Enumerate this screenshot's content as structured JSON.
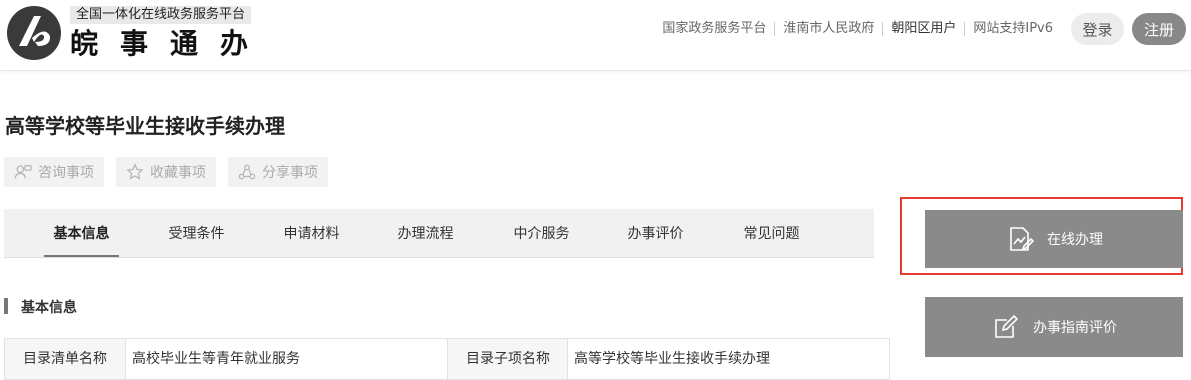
{
  "header": {
    "platform_line": "全国一体化在线政务服务平台",
    "brand": "皖事通办",
    "links": [
      "国家政务服务平台",
      "淮南市人民政府",
      "朝阳区用户",
      "网站支持IPv6"
    ],
    "login_label": "登录",
    "register_label": "注册"
  },
  "page": {
    "title": "高等学校等毕业生接收手续办理",
    "actions": [
      "咨询事项",
      "收藏事项",
      "分享事项"
    ]
  },
  "tabs": [
    "基本信息",
    "受理条件",
    "申请材料",
    "办理流程",
    "中介服务",
    "办事评价",
    "常见问题"
  ],
  "section": {
    "title": "基本信息",
    "row": {
      "label1": "目录清单名称",
      "value1": "高校毕业生等青年就业服务",
      "label2": "目录子项名称",
      "value2": "高等学校等毕业生接收手续办理"
    }
  },
  "side": {
    "online_label": "在线办理",
    "guide_label": "办事指南评价"
  },
  "colors": {
    "highlight": "#e63b2e",
    "button_gray": "#8a8a8a"
  }
}
